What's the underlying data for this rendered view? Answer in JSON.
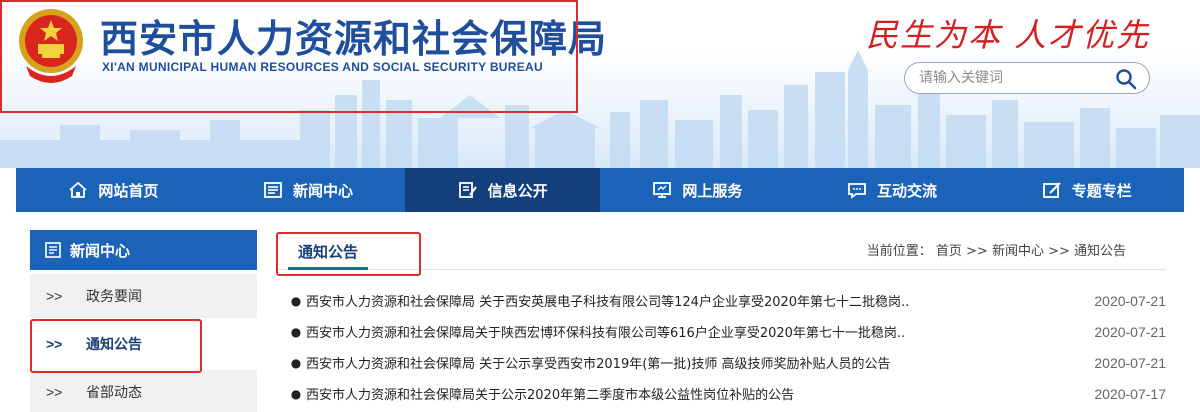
{
  "header": {
    "title_cn": "西安市人力资源和社会保障局",
    "title_en": "XI'AN MUNICIPAL HUMAN RESOURCES AND SOCIAL SECURITY BUREAU",
    "slogan": "民生为本  人才优先",
    "search": {
      "placeholder": "请输入关键词"
    }
  },
  "nav": {
    "items": [
      {
        "label": "网站首页",
        "icon": "home-icon"
      },
      {
        "label": "新闻中心",
        "icon": "news-icon"
      },
      {
        "label": "信息公开",
        "icon": "edit-icon",
        "active": true
      },
      {
        "label": "网上服务",
        "icon": "monitor-icon"
      },
      {
        "label": "互动交流",
        "icon": "chat-icon"
      },
      {
        "label": "专题专栏",
        "icon": "pen-icon"
      }
    ]
  },
  "sidebar": {
    "title": "新闻中心",
    "arrow": ">>",
    "items": [
      {
        "label": "政务要闻"
      },
      {
        "label": "通知公告",
        "active": true
      },
      {
        "label": "省部动态"
      }
    ]
  },
  "main": {
    "tab": "通知公告",
    "breadcrumb": "当前位置：  首页 >> 新闻中心 >> 通知公告",
    "news": [
      {
        "title": "西安市人力资源和社会保障局 关于西安英展电子科技有限公司等124户企业享受2020年第七十二批稳岗..",
        "date": "2020-07-21"
      },
      {
        "title": "西安市人力资源和社会保障局关于陕西宏博环保科技有限公司等616户企业享受2020年第七十一批稳岗..",
        "date": "2020-07-21"
      },
      {
        "title": "西安市人力资源和社会保障局 关于公示享受西安市2019年(第一批)技师 高级技师奖励补贴人员的公告",
        "date": "2020-07-21"
      },
      {
        "title": "西安市人力资源和社会保障局关于公示2020年第二季度市本级公益性岗位补贴的公告",
        "date": "2020-07-17"
      }
    ]
  },
  "colors": {
    "brand_blue": "#1a63b8",
    "nav_active": "#13407c",
    "title_blue": "#1f4f9c",
    "slogan_red": "#d42020",
    "highlight_red": "#e02b2b"
  }
}
